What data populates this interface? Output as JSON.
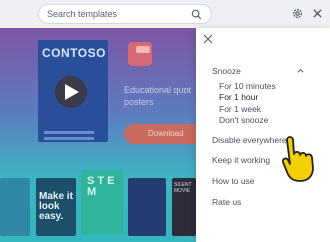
{
  "search": {
    "placeholder": "Search templates"
  },
  "background": {
    "poster_brand": "CONTOSO",
    "description": "Educational quot posters",
    "download_label": "Download",
    "thumbnails": [
      {
        "text": "Make it look easy."
      },
      {
        "text": "S T E M"
      },
      {
        "text": "SILENT MOVIE"
      }
    ]
  },
  "menu": {
    "snooze_label": "Snooze",
    "snooze_options": [
      "For 10 minutes",
      "For 1 hour",
      "For 1 week",
      "Don't snooze"
    ],
    "disable_label": "Disable everywhere",
    "keep_label": "Keep it working",
    "howto_label": "How to use",
    "rate_label": "Rate us"
  },
  "colors": {
    "accent_hand": "#f5d000",
    "panel_bg": "#ffffff",
    "overlay": "#6f64a8"
  }
}
